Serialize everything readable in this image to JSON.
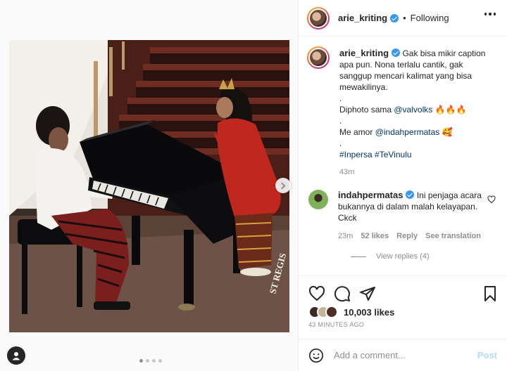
{
  "post": {
    "author": "arie_kriting",
    "separator": "•",
    "follow_status": "Following",
    "caption": {
      "lines": [
        "Gak bisa mikir caption apa pun. Nona terlalu cantik, gak sanggup mencari kalimat yang bisa mewakilinya."
      ],
      "dot1": ".",
      "photo_credit_prefix": "Diphoto sama ",
      "photo_credit_user": "@valvolks",
      "photo_credit_emoji": "🔥🔥🔥",
      "dot2": ".",
      "amor_prefix": "Me amor ",
      "amor_user": "@indahpermatas",
      "amor_emoji": "🥰",
      "dot3": ".",
      "hashtag1": "#Inpersa",
      "hashtag2": "#TeVinulu",
      "time": "43m"
    },
    "comments": [
      {
        "user": "indahpermatas",
        "text": "Ini penjaga acara bukannya di dalam malah kelayapan. Ckck",
        "time": "23m",
        "likes": "52 likes",
        "reply": "Reply",
        "translate": "See translation",
        "view_replies": "View replies (4)"
      }
    ],
    "likes_count": "10,003",
    "likes_label": "likes",
    "timestamp": "43 MINUTES AGO",
    "comment_placeholder": "Add a comment...",
    "post_button": "Post",
    "photo_sign": "ST REGIS",
    "carousel": {
      "count": 4,
      "active": 0
    }
  },
  "colors": {
    "verified": "#3897f0",
    "link": "#00376b",
    "muted": "#8e8e8e",
    "post_disabled": "#b3dbff",
    "dress": "#c0281f"
  },
  "icons": {
    "more": "more-horizontal-icon",
    "next": "chevron-right-icon",
    "tag": "user-tag-icon",
    "like": "heart-icon",
    "comment": "comment-icon",
    "share": "paper-plane-icon",
    "save": "bookmark-icon",
    "emoji": "smiley-icon"
  }
}
